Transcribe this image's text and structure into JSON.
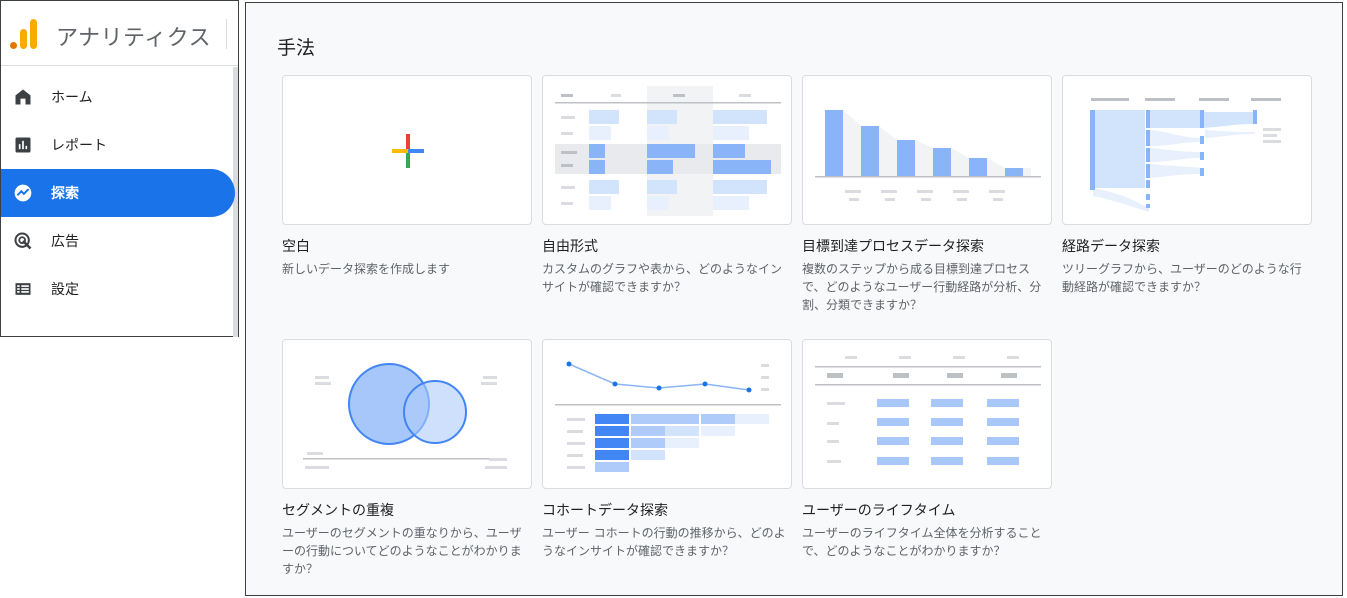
{
  "app": {
    "title": "アナリティクス"
  },
  "sidebar": {
    "items": [
      {
        "label": "ホーム",
        "icon": "home-icon",
        "active": false
      },
      {
        "label": "レポート",
        "icon": "bar-chart-icon",
        "active": false
      },
      {
        "label": "探索",
        "icon": "explore-icon",
        "active": true
      },
      {
        "label": "広告",
        "icon": "ads-target-icon",
        "active": false
      },
      {
        "label": "設定",
        "icon": "list-icon",
        "active": false
      }
    ]
  },
  "main": {
    "section_title": "手法",
    "techniques": [
      {
        "title": "空白",
        "description": "新しいデータ探索を作成します"
      },
      {
        "title": "自由形式",
        "description": "カスタムのグラフや表から、どのようなインサイトが確認できますか？"
      },
      {
        "title": "目標到達プロセスデータ探索",
        "description": "複数のステップから成る目標到達プロセスで、どのようなユーザー行動経路が分析、分割、分類できますか？"
      },
      {
        "title": "経路データ探索",
        "description": "ツリーグラフから、ユーザーのどのような行動経路が確認できますか？"
      },
      {
        "title": "セグメントの重複",
        "description": "ユーザーのセグメントの重なりから、ユーザーの行動についてどのようなことがわかりますか？"
      },
      {
        "title": "コホートデータ探索",
        "description": "ユーザー コホートの行動の推移から、どのようなインサイトが確認できますか？"
      },
      {
        "title": "ユーザーのライフタイム",
        "description": "ユーザーのライフタイム全体を分析することで、どのようなことがわかりますか？"
      }
    ]
  },
  "colors": {
    "accent": "#1a73e8",
    "thumb_blue": "#8ab4f8",
    "thumb_light": "#d2e3fc",
    "placeholder_gray": "#dadce0"
  }
}
